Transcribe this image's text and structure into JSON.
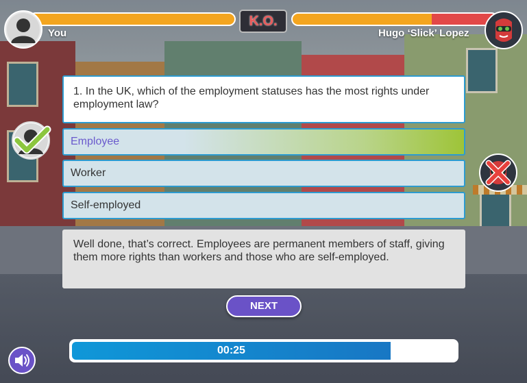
{
  "header": {
    "player_name": "You",
    "opponent_name": "Hugo ‘Slick’ Lopez",
    "ko_label": "K.O.",
    "player_health_fraction": 1.0,
    "opponent_health_fraction": 0.68,
    "player_bar_color": "#f3a51f",
    "opponent_bar_color_healthy": "#f3a51f",
    "opponent_bar_color_lost": "#e24848"
  },
  "quiz": {
    "question": "1. In the UK, which of the employment statuses has the most rights under employment law?",
    "answers": [
      {
        "label": "Employee",
        "state": "correct"
      },
      {
        "label": "Worker",
        "state": "default"
      },
      {
        "label": "Self-employed",
        "state": "default"
      }
    ],
    "feedback": "Well done, that’s correct. Employees are permanent members of staff, giving them more rights than workers and those who are self-employed.",
    "next_label": "NEXT",
    "player_result_icon": "checkmark-icon",
    "opponent_result_icon": "cross-icon",
    "accent_color": "#6a52c7"
  },
  "timer": {
    "time_label": "00:25",
    "remaining_fraction": 0.83
  },
  "controls": {
    "sound_icon": "speaker-icon"
  }
}
